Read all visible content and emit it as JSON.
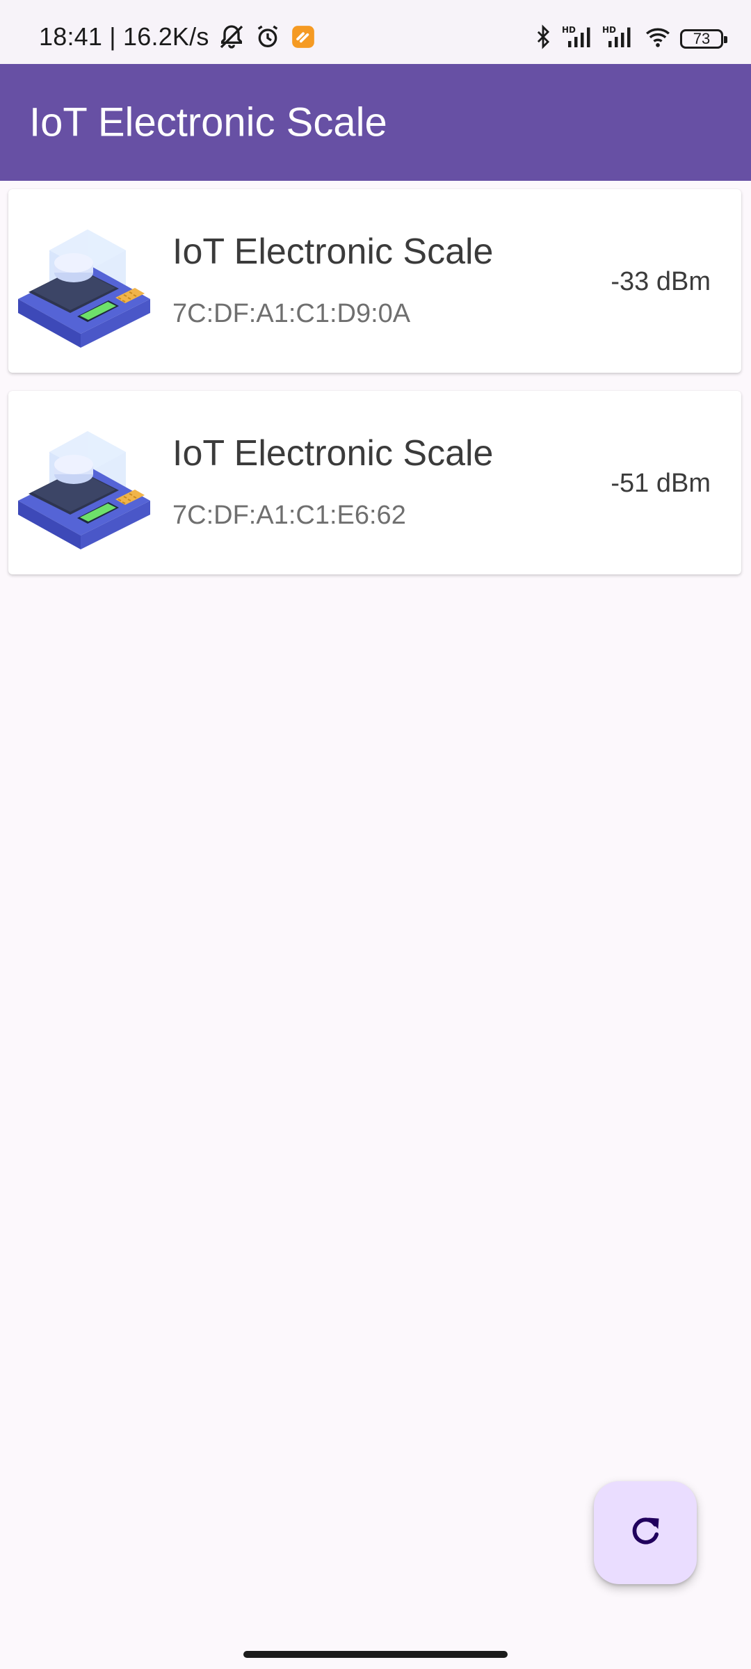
{
  "status_bar": {
    "time_speed": "18:41 | 16.2K/s",
    "battery": "73",
    "icons": [
      "notifications-off-icon",
      "alarm-icon",
      "app-notification-icon",
      "bluetooth-icon",
      "hd-signal-icon",
      "hd-signal-icon",
      "wifi-icon",
      "battery-icon"
    ]
  },
  "app_bar": {
    "title": "IoT Electronic Scale",
    "color": "#6750a4"
  },
  "devices": [
    {
      "name": "IoT Electronic Scale",
      "mac": "7C:DF:A1:C1:D9:0A",
      "rssi": "-33 dBm",
      "icon": "electronic-scale-icon"
    },
    {
      "name": "IoT Electronic Scale",
      "mac": "7C:DF:A1:C1:E6:62",
      "rssi": "-51 dBm",
      "icon": "electronic-scale-icon"
    }
  ],
  "fab": {
    "icon": "refresh-icon",
    "color": "#eaddff"
  }
}
